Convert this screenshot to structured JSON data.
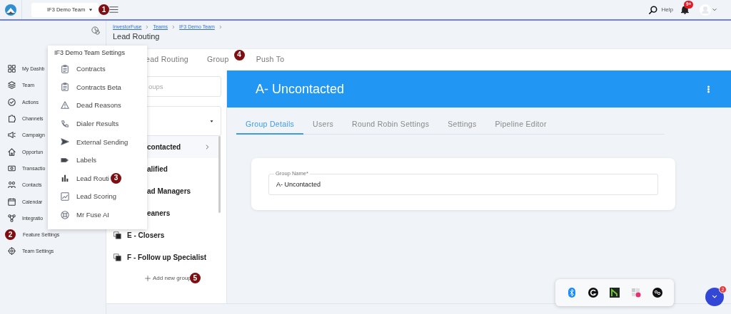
{
  "topbar": {
    "team_select": "IF3 Demo Team",
    "help": "Help",
    "notification_badge": "9+"
  },
  "annotations": [
    {
      "number": "1"
    },
    {
      "number": "2"
    },
    {
      "number": "3"
    },
    {
      "number": "4"
    },
    {
      "number": "5"
    }
  ],
  "sidebar": {
    "items": [
      {
        "label": "My Dashb"
      },
      {
        "label": "Team"
      },
      {
        "label": "Actions"
      },
      {
        "label": "Channels"
      },
      {
        "label": "Campaign"
      },
      {
        "label": "Opportun"
      },
      {
        "label": "Transactio"
      },
      {
        "label": "Contacts"
      },
      {
        "label": "Calendar"
      },
      {
        "label": "Integratio"
      },
      {
        "label": "Feature Settings"
      },
      {
        "label": "Team Settings"
      }
    ]
  },
  "breadcrumbs": [
    "InvestorFuse",
    "Teams",
    "IF3 Demo Team"
  ],
  "page_title": "Lead Routing",
  "page_tabs": [
    {
      "label": "ead Routing",
      "selected": false
    },
    {
      "label": "Group",
      "selected": false
    },
    {
      "label": "Push To",
      "selected": false
    }
  ],
  "settings_menu": {
    "title": "IF3 Demo Team Settings",
    "items": [
      "Contracts",
      "Contracts Beta",
      "Dead Reasons",
      "Dialer Results",
      "External Sending",
      "Labels",
      "Lead Routi",
      "Lead Scoring",
      "Mr Fuse AI"
    ]
  },
  "groups": {
    "search_placeholder": "oups",
    "items": [
      {
        "name": "contacted",
        "selected": true,
        "obscured": true
      },
      {
        "name": "alified",
        "selected": false,
        "obscured": true
      },
      {
        "name": "ad Managers",
        "selected": false,
        "obscured": true
      },
      {
        "name": "eaners",
        "selected": false,
        "obscured": true
      },
      {
        "name": "E - Closers",
        "selected": false,
        "obscured": false
      },
      {
        "name": "F - Follow up Specialist",
        "selected": false,
        "obscured": false
      }
    ],
    "add_button": "Add new group"
  },
  "group_detail": {
    "title": "A- Uncontacted",
    "tabs": [
      {
        "label": "Group Details",
        "selected": true
      },
      {
        "label": "Users",
        "selected": false
      },
      {
        "label": "Round Robin Settings",
        "selected": false
      },
      {
        "label": "Settings",
        "selected": false
      },
      {
        "label": "Pipeline Editor",
        "selected": false
      }
    ],
    "field": {
      "label": "Group Name*",
      "value": "A- Uncontacted"
    }
  },
  "chat": {
    "badge": "2"
  }
}
